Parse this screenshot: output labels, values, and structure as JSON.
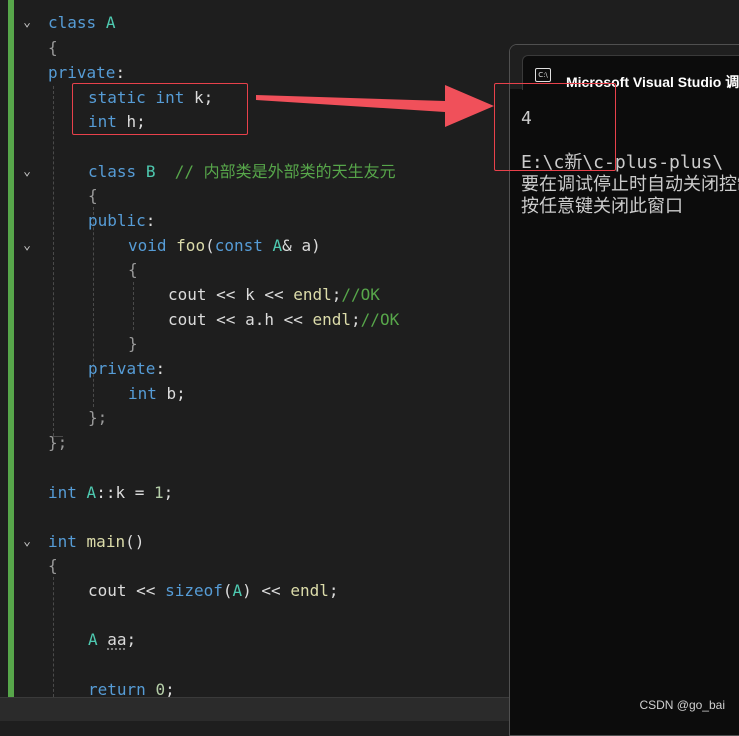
{
  "editor": {
    "lines": [
      {
        "tokens": [
          [
            "kw",
            "class"
          ],
          [
            "tx",
            " "
          ],
          [
            "ty",
            "A"
          ]
        ]
      },
      {
        "tokens": [
          [
            "pm",
            "{"
          ]
        ]
      },
      {
        "tokens": [
          [
            "kw",
            "private"
          ],
          [
            "tx",
            ":"
          ]
        ]
      },
      {
        "tokens": [
          [
            "kw",
            "static"
          ],
          [
            "tx",
            " "
          ],
          [
            "kw",
            "int"
          ],
          [
            "tx",
            " k;"
          ]
        ]
      },
      {
        "tokens": [
          [
            "kw",
            "int"
          ],
          [
            "tx",
            " h;"
          ]
        ]
      },
      {
        "tokens": []
      },
      {
        "tokens": [
          [
            "kw",
            "class"
          ],
          [
            "tx",
            " "
          ],
          [
            "ty",
            "B"
          ],
          [
            "tx",
            "  "
          ],
          [
            "cm",
            "// 内部类是外部类的天生友元"
          ]
        ]
      },
      {
        "tokens": [
          [
            "pm",
            "{"
          ]
        ]
      },
      {
        "tokens": [
          [
            "kw",
            "public"
          ],
          [
            "tx",
            ":"
          ]
        ]
      },
      {
        "tokens": [
          [
            "kw",
            "void"
          ],
          [
            "tx",
            " "
          ],
          [
            "fn",
            "foo"
          ],
          [
            "tx",
            "("
          ],
          [
            "kw",
            "const"
          ],
          [
            "tx",
            " "
          ],
          [
            "ty",
            "A"
          ],
          [
            "tx",
            "& a)"
          ]
        ]
      },
      {
        "tokens": [
          [
            "pm",
            "{"
          ]
        ]
      },
      {
        "tokens": [
          [
            "tx",
            "cout << k << "
          ],
          [
            "fn",
            "endl"
          ],
          [
            "tx",
            ";"
          ],
          [
            "cm",
            "//OK"
          ]
        ]
      },
      {
        "tokens": [
          [
            "tx",
            "cout << a.h << "
          ],
          [
            "fn",
            "endl"
          ],
          [
            "tx",
            ";"
          ],
          [
            "cm",
            "//OK"
          ]
        ]
      },
      {
        "tokens": [
          [
            "pm",
            "}"
          ]
        ]
      },
      {
        "tokens": [
          [
            "kw",
            "private"
          ],
          [
            "tx",
            ":"
          ]
        ]
      },
      {
        "tokens": [
          [
            "kw",
            "int"
          ],
          [
            "tx",
            " b;"
          ]
        ]
      },
      {
        "tokens": [
          [
            "pm",
            "};"
          ]
        ]
      },
      {
        "tokens": [
          [
            "pm",
            "};"
          ]
        ]
      },
      {
        "tokens": []
      },
      {
        "tokens": [
          [
            "kw",
            "int"
          ],
          [
            "tx",
            " "
          ],
          [
            "ty",
            "A"
          ],
          [
            "tx",
            "::k = "
          ],
          [
            "nm",
            "1"
          ],
          [
            "tx",
            ";"
          ]
        ]
      },
      {
        "tokens": []
      },
      {
        "tokens": [
          [
            "kw",
            "int"
          ],
          [
            "tx",
            " "
          ],
          [
            "fn",
            "main"
          ],
          [
            "tx",
            "()"
          ]
        ]
      },
      {
        "tokens": [
          [
            "pm",
            "{"
          ]
        ]
      },
      {
        "tokens": [
          [
            "tx",
            "cout << "
          ],
          [
            "kw",
            "sizeof"
          ],
          [
            "tx",
            "("
          ],
          [
            "ty",
            "A"
          ],
          [
            "tx",
            ") << "
          ],
          [
            "fn",
            "endl"
          ],
          [
            "tx",
            ";"
          ]
        ]
      },
      {
        "tokens": []
      },
      {
        "tokens": [
          [
            "ty",
            "A"
          ],
          [
            "tx",
            " "
          ],
          [
            "sq",
            "aa"
          ],
          [
            "tx",
            ";"
          ]
        ]
      },
      {
        "tokens": []
      },
      {
        "tokens": [
          [
            "kw",
            "return"
          ],
          [
            "tx",
            " "
          ],
          [
            "nm",
            "0"
          ],
          [
            "tx",
            ";"
          ]
        ]
      }
    ]
  },
  "console": {
    "title": "Microsoft Visual Studio 调试控制台",
    "output": [
      "4",
      "",
      "E:\\c新\\c-plus-plus\\",
      "要在调试停止时自动关闭控制台",
      "按任意键关闭此窗口"
    ]
  },
  "watermark": "CSDN @go_bai",
  "colors": {
    "keyword": "#569cd6",
    "type": "#4ec9b0",
    "function": "#dcdcaa",
    "comment": "#57a64a",
    "number": "#b5cea8",
    "annotation_red": "#e8414b",
    "console_bg": "#0c0c0c",
    "editor_bg": "#1e1e1e"
  },
  "icons": {
    "fold": "chevron-down-icon",
    "console_app": "console-app-icon"
  }
}
